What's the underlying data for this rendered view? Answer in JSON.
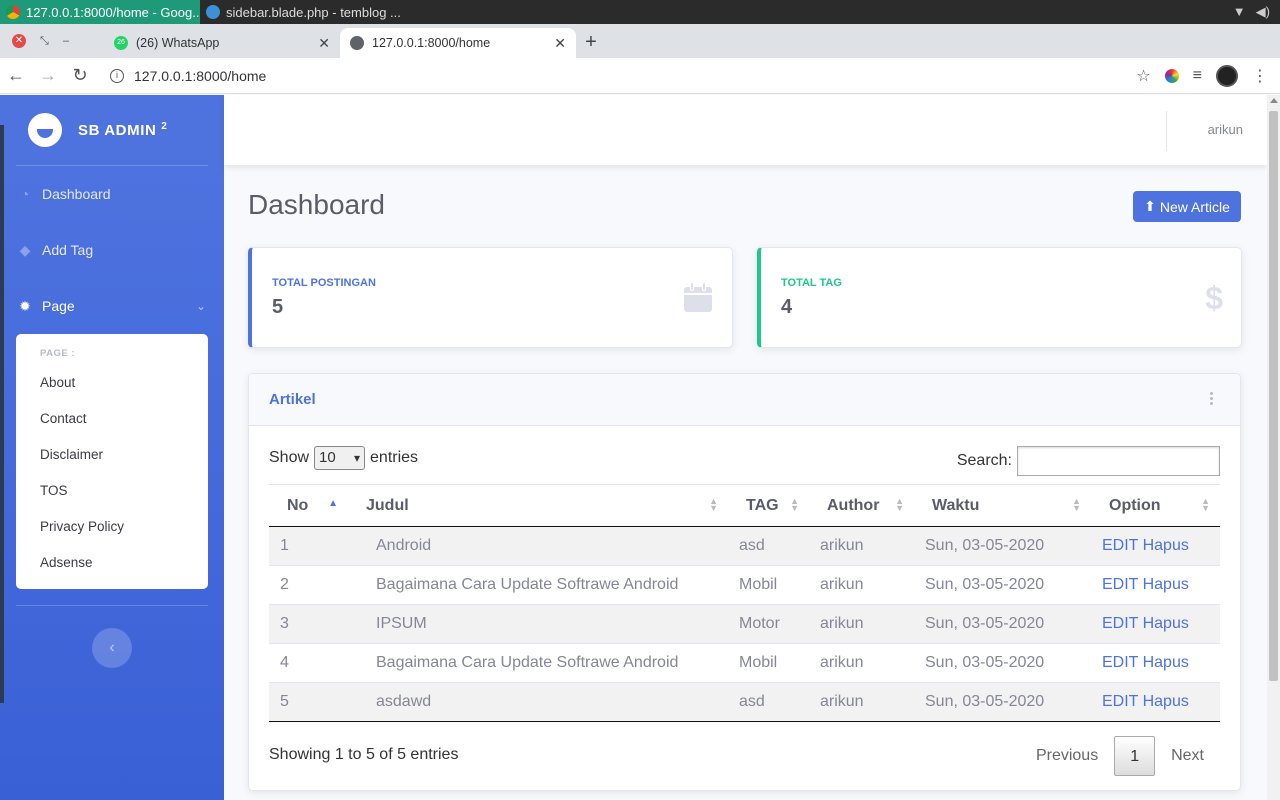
{
  "os": {
    "windows": [
      {
        "title": "127.0.0.1:8000/home - Goog..."
      },
      {
        "title": "sidebar.blade.php - temblog ..."
      }
    ]
  },
  "browser": {
    "tabs": [
      {
        "title": "(26) WhatsApp",
        "badge": "26"
      },
      {
        "title": "127.0.0.1:8000/home"
      }
    ],
    "url": "127.0.0.1:8000/home"
  },
  "sidebar": {
    "brand": "SB ADMIN",
    "brand_sup": "2",
    "items": [
      {
        "label": "Dashboard"
      },
      {
        "label": "Add Tag"
      },
      {
        "label": "Page"
      }
    ],
    "submenu": {
      "header": "PAGE :",
      "items": [
        "About",
        "Contact",
        "Disclaimer",
        "TOS",
        "Privacy Policy",
        "Adsense"
      ]
    }
  },
  "topbar": {
    "user": "arikun"
  },
  "main": {
    "title": "Dashboard",
    "new_button": "New Article",
    "stats": [
      {
        "label": "TOTAL POSTINGAN",
        "value": "5",
        "icon": "calendar-icon"
      },
      {
        "label": "TOTAL TAG",
        "value": "4",
        "icon": "dollar-icon",
        "icon_glyph": "$"
      }
    ],
    "table_card": {
      "title": "Artikel",
      "show_label": "Show",
      "entries_value": "10",
      "entries_label": "entries",
      "search_label": "Search:",
      "columns": [
        "No",
        "Judul",
        "TAG",
        "Author",
        "Waktu",
        "Option"
      ],
      "rows": [
        {
          "no": "1",
          "judul": "Android",
          "tag": "asd",
          "author": "arikun",
          "waktu": "Sun, 03-05-2020",
          "option": "EDIT Hapus"
        },
        {
          "no": "2",
          "judul": "Bagaimana Cara Update Softrawe Android",
          "tag": "Mobil",
          "author": "arikun",
          "waktu": "Sun, 03-05-2020",
          "option": "EDIT Hapus"
        },
        {
          "no": "3",
          "judul": "IPSUM",
          "tag": "Motor",
          "author": "arikun",
          "waktu": "Sun, 03-05-2020",
          "option": "EDIT Hapus"
        },
        {
          "no": "4",
          "judul": "Bagaimana Cara Update Softrawe Android",
          "tag": "Mobil",
          "author": "arikun",
          "waktu": "Sun, 03-05-2020",
          "option": "EDIT Hapus"
        },
        {
          "no": "5",
          "judul": "asdawd",
          "tag": "asd",
          "author": "arikun",
          "waktu": "Sun, 03-05-2020",
          "option": "EDIT Hapus"
        }
      ],
      "info": "Showing 1 to 5 of 5 entries",
      "pager": {
        "prev": "Previous",
        "current": "1",
        "next": "Next"
      }
    }
  },
  "colors": {
    "primary": "#4e73df",
    "success": "#1cc88a",
    "text": "#5a5c69",
    "muted": "#858796"
  }
}
